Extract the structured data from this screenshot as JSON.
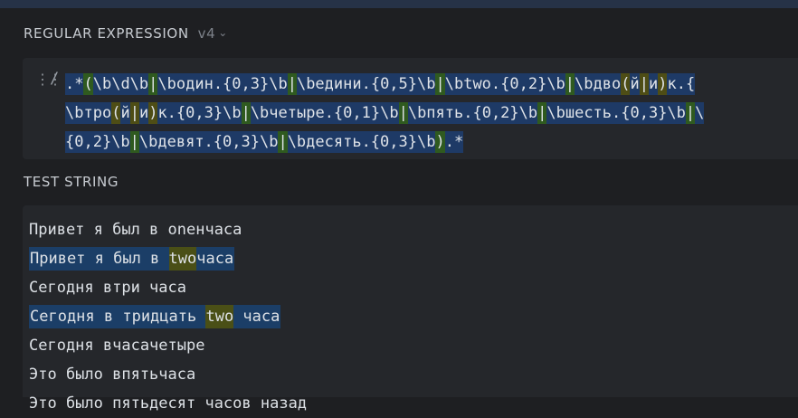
{
  "regex_section": {
    "title": "REGULAR EXPRESSION",
    "version": "v4",
    "delimiter": "/",
    "lines": [
      [
        {
          "t": ".*",
          "s": "b"
        },
        {
          "t": "(",
          "s": "g"
        },
        {
          "t": "\\b\\d\\b",
          "s": "b"
        },
        {
          "t": "|",
          "s": "g"
        },
        {
          "t": "\\bодин.{0,3}\\b",
          "s": "b"
        },
        {
          "t": "|",
          "s": "g"
        },
        {
          "t": "\\bедини.{0,5}\\b",
          "s": "b"
        },
        {
          "t": "|",
          "s": "g"
        },
        {
          "t": "\\btwo.{0,2}\\b",
          "s": "b"
        },
        {
          "t": "|",
          "s": "g"
        },
        {
          "t": "\\bдво",
          "s": "b"
        },
        {
          "t": "(",
          "s": "o"
        },
        {
          "t": "й",
          "s": "b"
        },
        {
          "t": "|",
          "s": "o"
        },
        {
          "t": "и",
          "s": "b"
        },
        {
          "t": ")",
          "s": "o"
        },
        {
          "t": "к.{",
          "s": "b"
        }
      ],
      [
        {
          "t": "\\bтро",
          "s": "b"
        },
        {
          "t": "(",
          "s": "o"
        },
        {
          "t": "й",
          "s": "b"
        },
        {
          "t": "|",
          "s": "o"
        },
        {
          "t": "и",
          "s": "b"
        },
        {
          "t": ")",
          "s": "o"
        },
        {
          "t": "к.{0,3}\\b",
          "s": "b"
        },
        {
          "t": "|",
          "s": "g"
        },
        {
          "t": "\\bчетыре.{0,1}\\b",
          "s": "b"
        },
        {
          "t": "|",
          "s": "g"
        },
        {
          "t": "\\bпять.{0,2}\\b",
          "s": "b"
        },
        {
          "t": "|",
          "s": "g"
        },
        {
          "t": "\\bшесть.{0,3}\\b",
          "s": "b"
        },
        {
          "t": "|",
          "s": "g"
        },
        {
          "t": "\\",
          "s": "b"
        }
      ],
      [
        {
          "t": "{0,2}\\b",
          "s": "b"
        },
        {
          "t": "|",
          "s": "g"
        },
        {
          "t": "\\bдевят.{0,3}\\b",
          "s": "b"
        },
        {
          "t": "|",
          "s": "g"
        },
        {
          "t": "\\bдесять.{0,3}\\b",
          "s": "b"
        },
        {
          "t": ")",
          "s": "g"
        },
        {
          "t": ".*",
          "s": "b"
        }
      ]
    ]
  },
  "test_section": {
    "title": "TEST STRING",
    "lines": [
      {
        "text": "Привет я был в oneнчаса",
        "match": false
      },
      {
        "text": "Привет я был в twoчаса",
        "match": true,
        "parts": [
          {
            "t": "Привет я был в ",
            "g": false
          },
          {
            "t": "two",
            "g": true
          },
          {
            "t": "часа",
            "g": false
          }
        ]
      },
      {
        "text": "Сегодня втри часа",
        "match": false
      },
      {
        "text": "Сегодня в тридцать two часа",
        "match": true,
        "parts": [
          {
            "t": "Сегодня в тридцать ",
            "g": false
          },
          {
            "t": "two",
            "g": true
          },
          {
            "t": " часа",
            "g": false
          }
        ]
      },
      {
        "text": "Сегодня вчасачетыре",
        "match": false
      },
      {
        "text": "Это было впятьчаса",
        "match": false
      },
      {
        "text": "Это было пятьдесят часов назад",
        "match": false
      }
    ]
  },
  "colors": {
    "match_bg": "#1b3e67",
    "group_bg": "#4a4f16",
    "alt_bg": "#2f5a1f",
    "subgroup_bg": "#4e4d15",
    "token_bg": "#1e3a66"
  }
}
